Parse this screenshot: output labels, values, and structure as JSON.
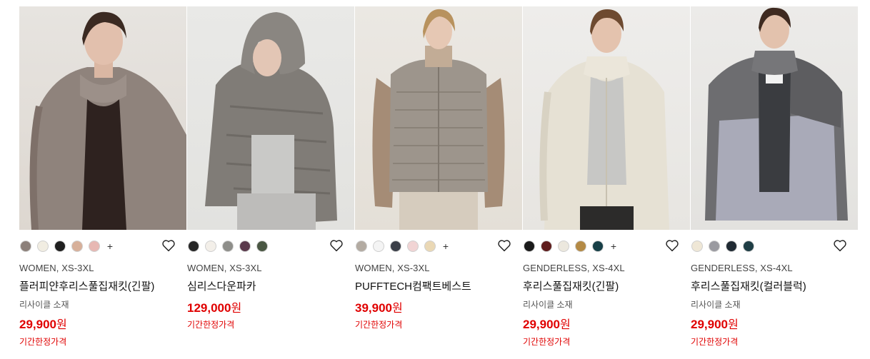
{
  "products": [
    {
      "meta": "WOMEN, XS-3XL",
      "name": "플러피얀후리스풀집재킷(긴팔)",
      "material": "리사이클 소재",
      "price": "29,900",
      "currency": "원",
      "tag": "기간한정가격",
      "swatches": [
        "#8c807a",
        "#f1ede2",
        "#1f1f1f",
        "#d7b09a",
        "#e7b8b3"
      ],
      "more": "+"
    },
    {
      "meta": "WOMEN, XS-3XL",
      "name": "심리스다운파카",
      "price": "129,000",
      "currency": "원",
      "tag": "기간한정가격",
      "swatches": [
        "#262626",
        "#f3efe9",
        "#8e8e8a",
        "#5a3a4c",
        "#4a5743"
      ]
    },
    {
      "meta": "WOMEN, XS-3XL",
      "name": "PUFFTECH컴팩트베스트",
      "price": "39,900",
      "currency": "원",
      "tag": "기간한정가격",
      "swatches": [
        "#b3aba2",
        "#f4f4f4",
        "#3b3f48",
        "#f1d4d4",
        "#ead8b5"
      ],
      "more": "+"
    },
    {
      "meta": "GENDERLESS, XS-4XL",
      "name": "후리스풀집재킷(긴팔)",
      "material": "리사이클 소재",
      "price": "29,900",
      "currency": "원",
      "tag": "기간한정가격",
      "swatches": [
        "#1a1a1a",
        "#5e1c1c",
        "#ece8de",
        "#b48a45",
        "#173f47"
      ],
      "more": "+"
    },
    {
      "meta": "GENDERLESS, XS-4XL",
      "name": "후리스풀집재킷(컬러블럭)",
      "material": "리사이클 소재",
      "price": "29,900",
      "currency": "원",
      "tag": "기간한정가격",
      "swatches": [
        "#efe7d6",
        "#9a9aa0",
        "#202a33",
        "#1f3e45"
      ]
    }
  ],
  "colors": {
    "price": "#e00000",
    "accent": "#e00000"
  },
  "icons": {
    "favorite": "heart-outline-icon"
  }
}
